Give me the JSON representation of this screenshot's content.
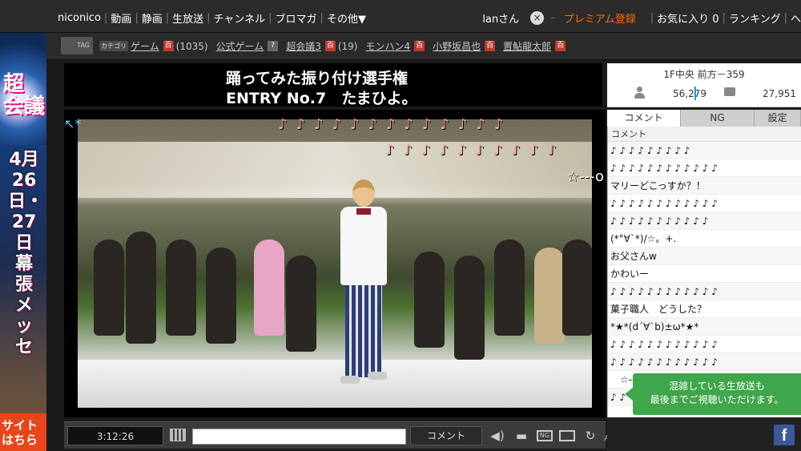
{
  "topnav": {
    "left": [
      "niconico",
      "動画",
      "静画",
      "生放送",
      "チャンネル",
      "ブロマガ",
      "その他▼"
    ],
    "user": "lanさん",
    "premium": "プレミアム登録",
    "favorites": "お気に入り 0",
    "ranking": "ランキング",
    "help": "ヘ"
  },
  "left_ad": {
    "headline": "4月26日・27日幕張メッセ",
    "footer": "サイトはちら"
  },
  "tags": {
    "icon": "TAG",
    "items": [
      {
        "category": "カテゴリ",
        "name": "ゲーム",
        "count": "(1035)",
        "dic": true
      },
      {
        "category": "",
        "name": "公式ゲーム",
        "count": "",
        "dic": false
      },
      {
        "category": "",
        "name": "超会議3",
        "count": "(19)",
        "dic": true
      },
      {
        "category": "",
        "name": "モンハン4",
        "count": "",
        "dic": true
      },
      {
        "category": "",
        "name": "小野坂昌也",
        "count": "",
        "dic": true
      },
      {
        "category": "",
        "name": "置鮎龍太郎",
        "count": "",
        "dic": true
      }
    ]
  },
  "stream": {
    "title_line1": "踊ってみた振り付け選手権",
    "title_line2": "ENTRY No.7　たまひよ。"
  },
  "overlay": {
    "row1": "♪♪♪♪♪♪♪♪♪♪♪♪♪",
    "row2": "♪♪♪♪♪♪♪♪♪♪",
    "star": "☆---o",
    "arrow": "↖*"
  },
  "info": {
    "location": "1F中央 前方－359",
    "viewers": "56,279",
    "comments": "27,951"
  },
  "tabs": [
    "コメント",
    "NG",
    "設定"
  ],
  "comment_list": {
    "header": "コメント",
    "rows": [
      "♪ ♪ ♪ ♪ ♪ ♪ ♪ ♪ ♪",
      "♪ ♪ ♪ ♪ ♪ ♪ ♪ ♪ ♪ ♪ ♪ ♪",
      "マリーどこっすか？！",
      "♪ ♪ ♪ ♪ ♪ ♪ ♪ ♪ ♪ ♪ ♪ ♪",
      "♪ ♪ ♪ ♪ ♪ ♪ ♪ ♪ ♪ ♪ ♪",
      "(*°∀`*)/☆。+.",
      "お父さんw",
      "かわいー",
      "♪ ♪ ♪ ♪ ♪ ♪ ♪ ♪ ♪ ♪ ♪ ♪",
      "菓子職人　どうした？",
      "*★*(d´∀`b)±ω*★*",
      "♪ ♪ ♪ ♪ ♪ ♪ ♪ ♪ ♪ ♪ ♪ ♪",
      "♪ ♪ ♪ ♪ ♪ ♪ ♪ ♪ ♪ ♪ ♪ ♪",
      "　☆-----",
      "♪ ♪"
    ]
  },
  "toast": {
    "line1": "混雑している生放送も",
    "line2": "最後までご視聴いただけます。"
  },
  "controls": {
    "time": "3:12:26",
    "comment_placeholder": "",
    "submit": "コメント",
    "ng_label": "NG",
    "app_label": "APP"
  },
  "facebook": "f"
}
